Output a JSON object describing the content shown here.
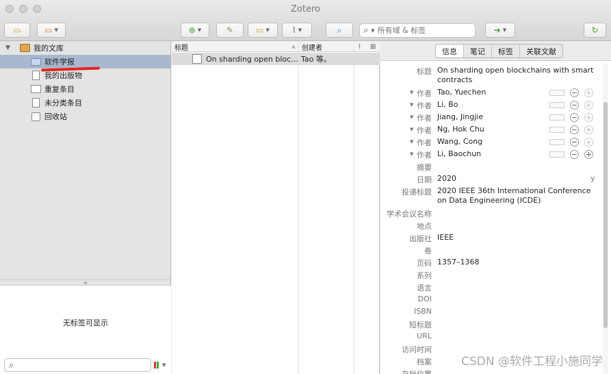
{
  "window": {
    "title": "Zotero"
  },
  "toolbar": {
    "search_placeholder": "所有域 & 标签"
  },
  "tree": {
    "items": [
      {
        "label": "我的文库"
      },
      {
        "label": "软件学报"
      },
      {
        "label": "我的出版物"
      },
      {
        "label": "重复条目"
      },
      {
        "label": "未分类条目"
      },
      {
        "label": "回收站"
      }
    ]
  },
  "tags": {
    "empty_text": "无标签可显示"
  },
  "items_pane": {
    "columns": {
      "title": "标题",
      "creator": "创建者"
    },
    "rows": [
      {
        "title": "On sharding open blockchains with smart contracts",
        "creator": "Tao 等。"
      }
    ]
  },
  "item_pane": {
    "tabs": [
      "信息",
      "笔记",
      "标签",
      "关联文献"
    ],
    "fields": {
      "title_label": "标题",
      "title_value": "On sharding open blockchains with smart contracts",
      "author_label": "作者",
      "authors": [
        "Tao, Yuechen",
        "Li, Bo",
        "Jiang, Jingjie",
        "Ng, Hok Chu",
        "Wang, Cong",
        "Li, Baochun"
      ],
      "abstract_label": "摘要",
      "date_label": "日期",
      "date_value": "2020",
      "date_flag": "y",
      "proceedings_label": "投递标题",
      "proceedings_value": "2020 IEEE 36th International Conference on Data Engineering (ICDE)",
      "conference_label": "学术会议名称",
      "place_label": "地点",
      "publisher_label": "出版社",
      "publisher_value": "IEEE",
      "volume_label": "卷",
      "pages_label": "页码",
      "pages_value": "1357–1368",
      "series_label": "系列",
      "language_label": "语言",
      "doi_label": "DOI",
      "isbn_label": "ISBN",
      "short_title_label": "短标题",
      "url_label": "URL",
      "accessed_label": "访问时间",
      "archive_label": "档案",
      "archive_loc_label": "存档位置"
    }
  },
  "watermark": "CSDN @软件工程小施同学",
  "colors": {
    "selection": "#a9b8cf",
    "annotation": "#e8251b"
  }
}
